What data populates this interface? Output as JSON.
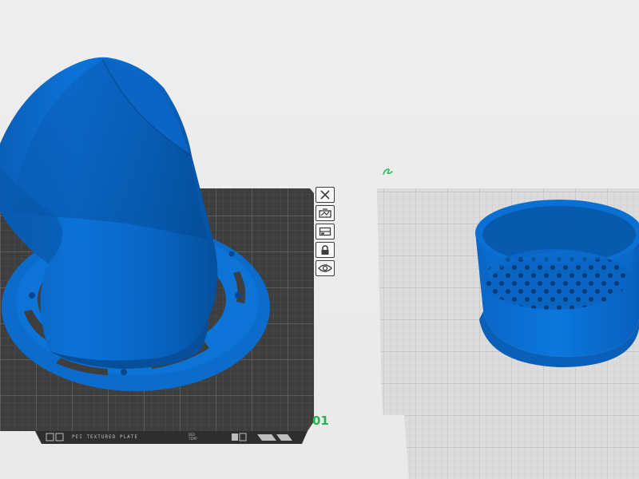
{
  "plate_toolbar": [
    {
      "icon": "close-icon",
      "label": ""
    },
    {
      "icon": "arrange-icon",
      "label": ""
    },
    {
      "icon": "orient-icon",
      "label": ""
    },
    {
      "icon": "lock-icon",
      "label": ""
    },
    {
      "icon": "settings-icon",
      "label": ""
    }
  ],
  "plate_1": {
    "number": "01",
    "label_text": "PEI TEXTURED PLATE",
    "label_small": "BED TEMP"
  },
  "plate_2": {
    "edit_icon": "edit-icon"
  },
  "colors": {
    "model_blue": "#0a6ccc",
    "plate_dark": "#3e3e3e",
    "plate_light": "#dcdcdc",
    "plate_number": "#1fb84a",
    "edit_marker": "#1fb84a"
  }
}
